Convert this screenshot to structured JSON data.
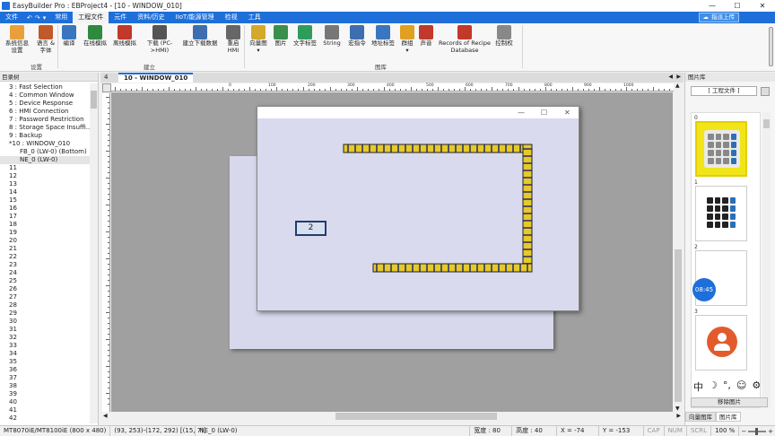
{
  "titlebar": {
    "title": "EasyBuilder Pro : EBProject4 - [10 - WINDOW_010]",
    "min": "—",
    "max": "☐",
    "close": "✕"
  },
  "menubar": {
    "items": [
      "文件",
      "常用",
      "工程文件",
      "元件",
      "资料/历史",
      "IIoT/能源管理",
      "检视",
      "工具"
    ],
    "active_index": 2,
    "quick": [
      "↶",
      "↷",
      "▾"
    ],
    "upload": "指派上传"
  },
  "ribbon": {
    "buttons": [
      {
        "label": "系统信息\n设置",
        "color": "#e8a13a"
      },
      {
        "label": "语言 &\n字体",
        "color": "#c05a2a"
      },
      {
        "label": "编译",
        "color": "#3a75c0"
      },
      {
        "label": "在线模拟",
        "color": "#2d8a3e"
      },
      {
        "label": "离线模拟",
        "color": "#c0392b"
      },
      {
        "label": "下载 (PC-\n>HMI)",
        "color": "#555"
      },
      {
        "label": "建立下载数据",
        "color": "#3d6fb0"
      },
      {
        "label": "重启\nHMI",
        "color": "#666"
      },
      {
        "label": "向量图\n▾",
        "color": "#d4a82a"
      },
      {
        "label": "图片",
        "color": "#3a8f4a"
      },
      {
        "label": "文字标签",
        "color": "#2e9d5b"
      },
      {
        "label": "String",
        "color": "#777"
      },
      {
        "label": "宏指令",
        "color": "#3d6fb0"
      },
      {
        "label": "地址标签",
        "color": "#3a75c0"
      },
      {
        "label": "群组\n▾",
        "color": "#e0a020"
      },
      {
        "label": "声音",
        "color": "#c0392b"
      },
      {
        "label": "Records of Recipe\nDatabase",
        "color": "#c0392b"
      },
      {
        "label": "控制权",
        "color": "#888"
      }
    ],
    "groups": [
      "设置",
      "建立",
      "图库"
    ]
  },
  "leftpanel": {
    "header": "目录树",
    "items": [
      {
        "text": "3 : Fast Selection",
        "level": 1
      },
      {
        "text": "4 : Common Window",
        "level": 1
      },
      {
        "text": "5 : Device Response",
        "level": 1
      },
      {
        "text": "6 : HMI Connection",
        "level": 1
      },
      {
        "text": "7 : Password Restriction",
        "level": 1
      },
      {
        "text": "8 : Storage Space Insuffi...",
        "level": 1
      },
      {
        "text": "9 : Backup",
        "level": 1
      },
      {
        "text": "*10 : WINDOW_010",
        "level": 1
      },
      {
        "text": "FB_0 (LW-0) (Bottom)",
        "level": 2
      },
      {
        "text": "NE_0 (LW-0)",
        "level": 2,
        "selected": true
      },
      {
        "text": "11",
        "level": 1
      },
      {
        "text": "12",
        "level": 1
      },
      {
        "text": "13",
        "level": 1
      },
      {
        "text": "14",
        "level": 1
      },
      {
        "text": "15",
        "level": 1
      },
      {
        "text": "16",
        "level": 1
      },
      {
        "text": "17",
        "level": 1
      },
      {
        "text": "18",
        "level": 1
      },
      {
        "text": "19",
        "level": 1
      },
      {
        "text": "20",
        "level": 1
      },
      {
        "text": "21",
        "level": 1
      },
      {
        "text": "22",
        "level": 1
      },
      {
        "text": "23",
        "level": 1
      },
      {
        "text": "24",
        "level": 1
      },
      {
        "text": "25",
        "level": 1
      },
      {
        "text": "26",
        "level": 1
      },
      {
        "text": "27",
        "level": 1
      },
      {
        "text": "28",
        "level": 1
      },
      {
        "text": "29",
        "level": 1
      },
      {
        "text": "30",
        "level": 1
      },
      {
        "text": "31",
        "level": 1
      },
      {
        "text": "32",
        "level": 1
      },
      {
        "text": "33",
        "level": 1
      },
      {
        "text": "34",
        "level": 1
      },
      {
        "text": "35",
        "level": 1
      },
      {
        "text": "36",
        "level": 1
      },
      {
        "text": "37",
        "level": 1
      },
      {
        "text": "38",
        "level": 1
      },
      {
        "text": "39",
        "level": 1
      },
      {
        "text": "40",
        "level": 1
      },
      {
        "text": "41",
        "level": 1
      },
      {
        "text": "42",
        "level": 1
      }
    ]
  },
  "editor": {
    "tab_index": "4",
    "tab_label": "10 - WINDOW_010",
    "window_controls": [
      "—",
      "☐",
      "✕"
    ],
    "numeric_value": "2",
    "ruler_marks": [
      "0",
      "100",
      "200",
      "300",
      "400",
      "500",
      "600",
      "700",
      "800",
      "900",
      "1000"
    ]
  },
  "rightpanel": {
    "header": "图片库",
    "selector": "[ 工程文件 ]",
    "thumbnails": [
      {
        "num": "0"
      },
      {
        "num": "1"
      },
      {
        "num": "2",
        "clock": "08:45"
      },
      {
        "num": "3"
      }
    ],
    "ime": [
      "中",
      "☽",
      "°,",
      "☺",
      "⚙"
    ],
    "remove_button": "移除图片",
    "tabs": [
      "向量图库",
      "图片库"
    ]
  },
  "statusbar": {
    "model": "MT8070iE/MT8100iE (800 x 480)",
    "coords": "(93, 253)-(172, 292) [(15, 7)]",
    "object": "NE_0 (LW-0)",
    "width": "宽度 : 80",
    "height": "高度 : 40",
    "x": "X = -74",
    "y": "Y = -153",
    "cap": "CAP",
    "num": "NUM",
    "scrl": "SCRL",
    "zoom": "100 %"
  }
}
